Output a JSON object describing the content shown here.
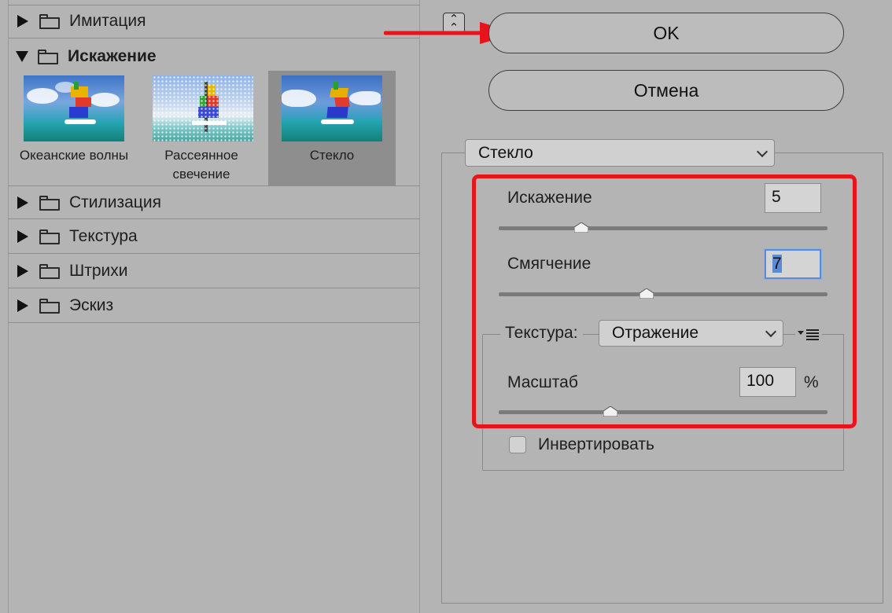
{
  "categories": [
    {
      "label": "Имитация",
      "expanded": false
    },
    {
      "label": "Искажение",
      "expanded": true
    },
    {
      "label": "Стилизация",
      "expanded": false
    },
    {
      "label": "Текстура",
      "expanded": false
    },
    {
      "label": "Штрихи",
      "expanded": false
    },
    {
      "label": "Эскиз",
      "expanded": false
    }
  ],
  "thumbnails": [
    {
      "caption": "Океанские волны",
      "selected": false
    },
    {
      "caption": "Рассеянное свечение",
      "selected": false
    },
    {
      "caption": "Стекло",
      "selected": true
    }
  ],
  "buttons": {
    "ok": "OK",
    "cancel": "Отмена"
  },
  "filter_select": "Стекло",
  "params": {
    "distortion": {
      "label": "Искажение",
      "value": "5",
      "slider_fraction": 0.25
    },
    "smoothness": {
      "label": "Смягчение",
      "value": "7",
      "slider_fraction": 0.45
    },
    "texture": {
      "label": "Текстура:",
      "value": "Отражение"
    },
    "scale": {
      "label": "Масштаб",
      "value": "100",
      "unit": "%",
      "slider_fraction": 0.34
    },
    "invert": {
      "label": "Инвертировать",
      "checked": false
    }
  },
  "colors": {
    "annotation_red": "#e8141c",
    "selection_blue": "#5b8bd6",
    "panel_bg": "#b4b4b4"
  }
}
